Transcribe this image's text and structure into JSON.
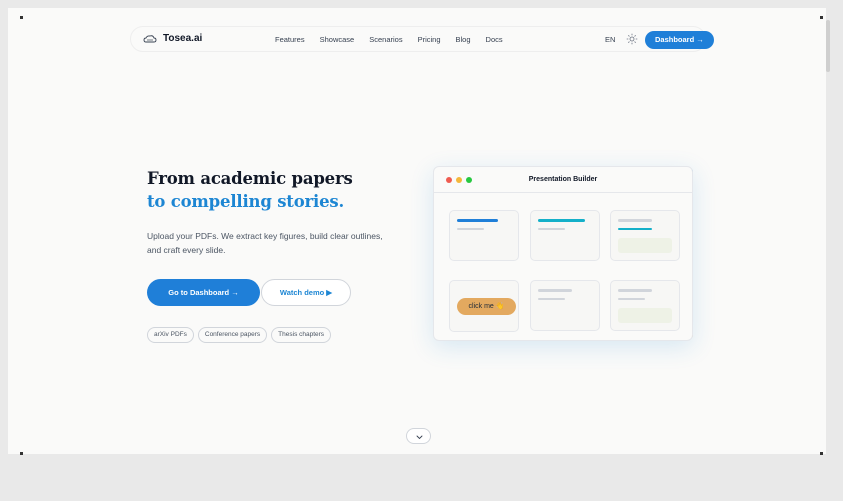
{
  "nav": {
    "logo": "Tosea.ai",
    "links": [
      "Features",
      "Showcase",
      "Scenarios",
      "Pricing",
      "Blog",
      "Docs"
    ],
    "lang": "EN",
    "dashboard_label": "Dashboard →"
  },
  "hero": {
    "title_line1": "From academic papers",
    "title_line2": "to compelling stories.",
    "subtitle": "Upload your PDFs. We extract key figures, build clear outlines, and craft every slide.",
    "primary_cta": "Go to Dashboard →",
    "secondary_cta": "Watch demo ▶",
    "chips": [
      "arXiv PDFs",
      "Conference papers",
      "Thesis chapters"
    ]
  },
  "builder": {
    "title": "Presentation Builder",
    "click_label": "click me 👋"
  },
  "colors": {
    "accent": "#1f7fd8",
    "accent_text": "#1d86d3",
    "dot_red": "#ef5b50",
    "dot_yellow": "#f4b73b",
    "dot_green": "#27c840",
    "cyan": "#14b0c9",
    "orange": "#e3a95f"
  },
  "icons": {
    "logo": "cloud-icon",
    "theme": "sun-icon",
    "scroll": "chevron-down-icon"
  }
}
